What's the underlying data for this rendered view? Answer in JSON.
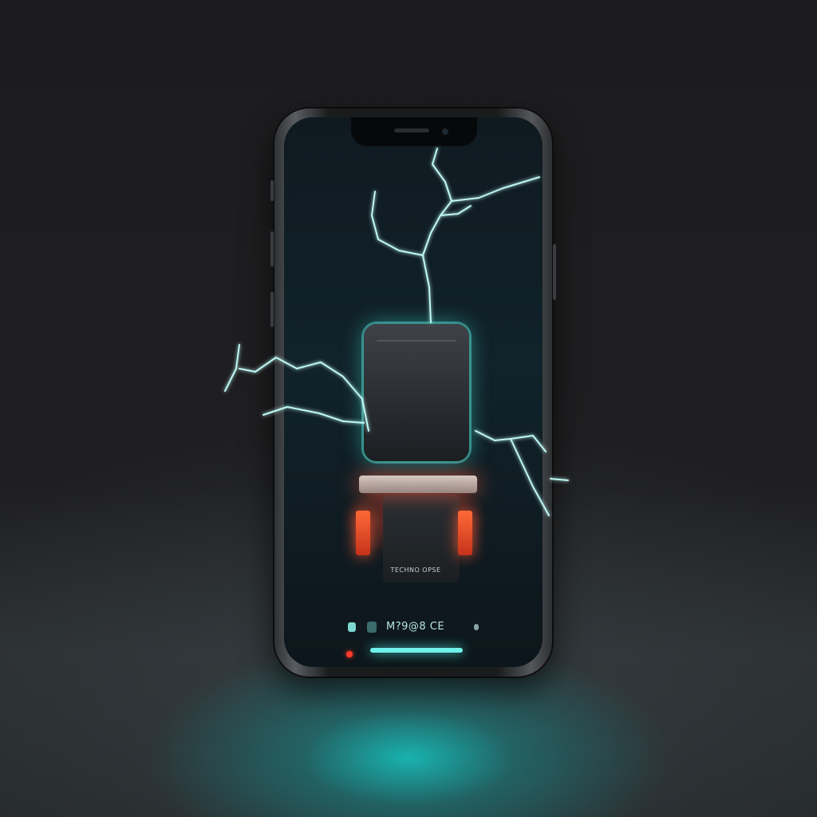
{
  "scene": {
    "subject": "smartphone",
    "accent_color": "#4fe8e0",
    "warning_color": "#ff5a36"
  },
  "screen": {
    "device_caption": "TECHNO OPSE",
    "dock_label": "M?9@8 CE"
  }
}
